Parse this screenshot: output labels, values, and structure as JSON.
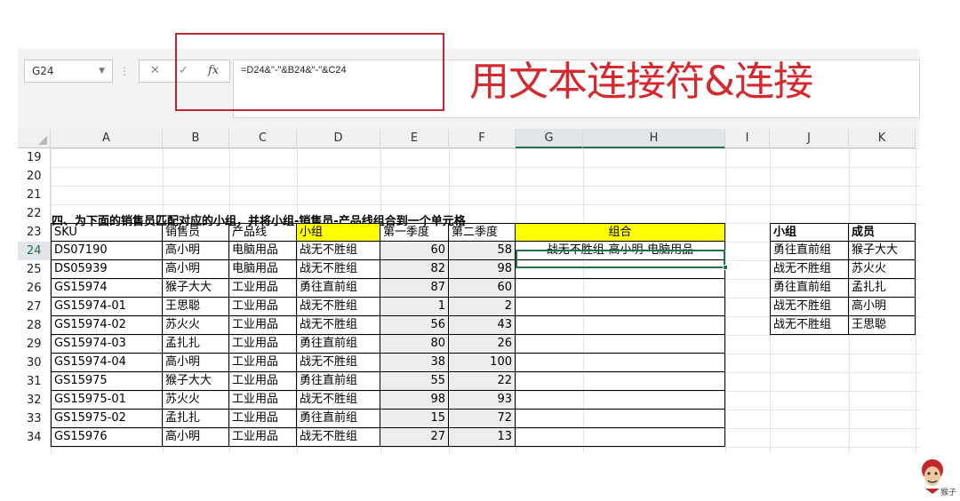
{
  "formula_bar": {
    "name_box": "G24",
    "cancel_symbol": "✕",
    "enter_symbol": "✓",
    "fx_label": "fx",
    "formula": "=D24&\"-\"&B24&\"-\"&C24"
  },
  "annotation": {
    "title": "用文本连接符&连接"
  },
  "columns": [
    "A",
    "B",
    "C",
    "D",
    "E",
    "F",
    "G",
    "H",
    "I",
    "J",
    "K"
  ],
  "rows": [
    "19",
    "20",
    "21",
    "22",
    "23",
    "24",
    "25",
    "26",
    "27",
    "28",
    "29",
    "30",
    "31",
    "32",
    "33",
    "34"
  ],
  "note": "四、为下面的销售员匹配对应的小组，并将小组-销售员-产品线组合到一个单元格",
  "table": {
    "headers": [
      "SKU",
      "销售员",
      "产品线",
      "小组",
      "第一季度",
      "第二季度",
      "组合"
    ],
    "rows": [
      [
        "DS07190",
        "高小明",
        "电脑用品",
        "战无不胜组",
        "60",
        "58",
        "战无不胜组-高小明-电脑用品"
      ],
      [
        "DS05939",
        "高小明",
        "电脑用品",
        "战无不胜组",
        "82",
        "98",
        ""
      ],
      [
        "GS15974",
        "猴子大大",
        "工业用品",
        "勇往直前组",
        "87",
        "60",
        ""
      ],
      [
        "GS15974-01",
        "王思聪",
        "工业用品",
        "战无不胜组",
        "1",
        "2",
        ""
      ],
      [
        "GS15974-02",
        "苏火火",
        "工业用品",
        "战无不胜组",
        "56",
        "43",
        ""
      ],
      [
        "GS15974-03",
        "孟扎扎",
        "工业用品",
        "勇往直前组",
        "80",
        "26",
        ""
      ],
      [
        "GS15974-04",
        "高小明",
        "工业用品",
        "战无不胜组",
        "38",
        "100",
        ""
      ],
      [
        "GS15975",
        "猴子大大",
        "工业用品",
        "勇往直前组",
        "55",
        "22",
        ""
      ],
      [
        "GS15975-01",
        "苏火火",
        "工业用品",
        "战无不胜组",
        "98",
        "93",
        ""
      ],
      [
        "GS15975-02",
        "孟扎扎",
        "工业用品",
        "勇往直前组",
        "15",
        "72",
        ""
      ],
      [
        "GS15976",
        "高小明",
        "工业用品",
        "战无不胜组",
        "27",
        "13",
        ""
      ]
    ]
  },
  "lookup": {
    "headers": [
      "小组",
      "成员"
    ],
    "rows": [
      [
        "勇往直前组",
        "猴子大大"
      ],
      [
        "战无不胜组",
        "苏火火"
      ],
      [
        "勇往直前组",
        "孟扎扎"
      ],
      [
        "战无不胜组",
        "高小明"
      ],
      [
        "战无不胜组",
        "王思聪"
      ]
    ]
  },
  "watermark": {
    "text": "猴子"
  },
  "colors": {
    "accent": "#217346",
    "highlight": "#ffff00",
    "annotation_red": "#d42a2f"
  }
}
